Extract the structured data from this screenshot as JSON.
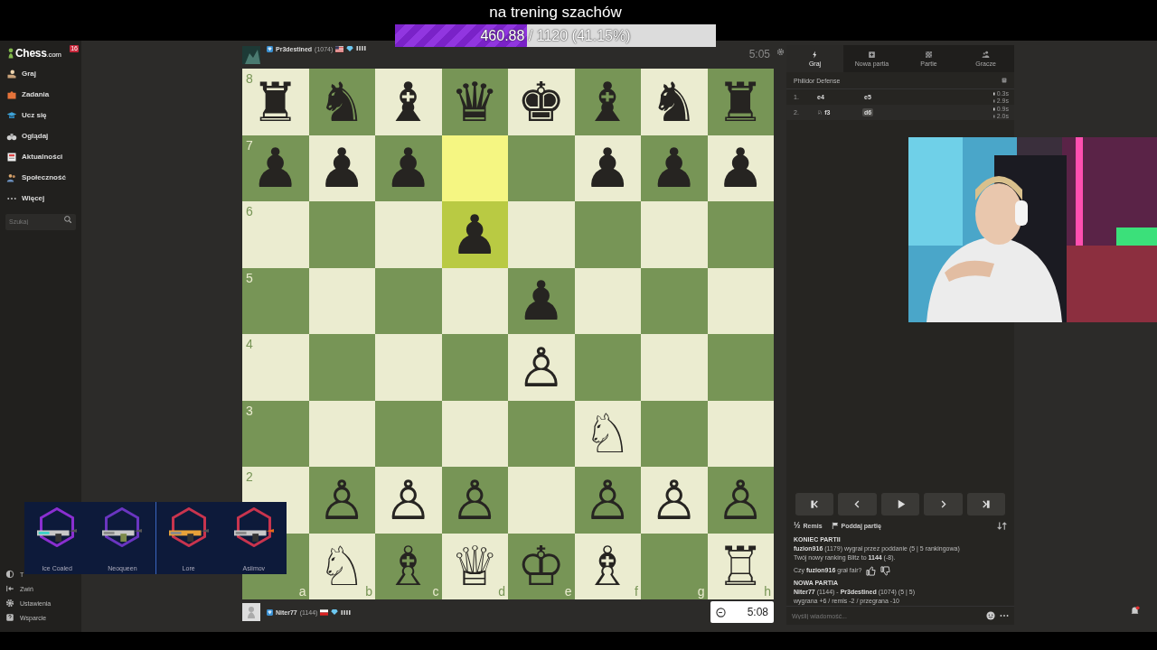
{
  "stream_overlay": {
    "title": "na trening szachów",
    "progress": {
      "level": 0.4115,
      "reading": "460.88 / 1120 (41.15%)"
    }
  },
  "sidebar": {
    "logo": {
      "name": "Chess",
      "suffix": ".com"
    },
    "notification_count": "16",
    "items": [
      {
        "label": "Graj"
      },
      {
        "label": "Zadania"
      },
      {
        "label": "Ucz się"
      },
      {
        "label": "Oglądaj"
      },
      {
        "label": "Aktualności"
      },
      {
        "label": "Społeczność"
      },
      {
        "label": "Więcej"
      }
    ],
    "search": {
      "placeholder": "Szukaj"
    },
    "footer_items": [
      {
        "label": "T"
      },
      {
        "label": "Zwiń"
      },
      {
        "label": "Ustawienia"
      },
      {
        "label": "Wsparcie"
      }
    ]
  },
  "players": [
    {
      "name": "Pr3destined",
      "rating": "(1074)",
      "clock": "5:05",
      "active": false
    },
    {
      "name": "Niter77",
      "rating": "(1144)",
      "clock": "5:08",
      "active": true
    }
  ],
  "board": {
    "ranks": [
      {
        "label": "8",
        "squares": [
          {
            "piece": "♜",
            "highlighted": false
          },
          {
            "piece": "♞",
            "highlighted": false
          },
          {
            "piece": "♝",
            "highlighted": false
          },
          {
            "piece": "♛",
            "highlighted": false
          },
          {
            "piece": "♚",
            "highlighted": false
          },
          {
            "piece": "♝",
            "highlighted": false
          },
          {
            "piece": "♞",
            "highlighted": false
          },
          {
            "piece": "♜",
            "highlighted": false
          }
        ]
      },
      {
        "label": "7",
        "squares": [
          {
            "piece": "♟",
            "highlighted": false
          },
          {
            "piece": "♟",
            "highlighted": false
          },
          {
            "piece": "♟",
            "highlighted": false
          },
          {
            "highlighted": true
          },
          {
            "highlighted": false
          },
          {
            "piece": "♟",
            "highlighted": false
          },
          {
            "piece": "♟",
            "highlighted": false
          },
          {
            "piece": "♟",
            "highlighted": false
          }
        ]
      },
      {
        "label": "6",
        "squares": [
          {
            "highlighted": false
          },
          {
            "highlighted": false
          },
          {
            "highlighted": false
          },
          {
            "piece": "♟",
            "highlighted": true
          },
          {
            "highlighted": false
          },
          {
            "highlighted": false
          },
          {
            "highlighted": false
          },
          {
            "highlighted": false
          }
        ]
      },
      {
        "label": "5",
        "squares": [
          {
            "highlighted": false
          },
          {
            "highlighted": false
          },
          {
            "highlighted": false
          },
          {
            "highlighted": false
          },
          {
            "piece": "♟",
            "highlighted": false
          },
          {
            "highlighted": false
          },
          {
            "highlighted": false
          },
          {
            "highlighted": false
          }
        ]
      },
      {
        "label": "4",
        "squares": [
          {
            "highlighted": false
          },
          {
            "highlighted": false
          },
          {
            "highlighted": false
          },
          {
            "highlighted": false
          },
          {
            "piece": "♙",
            "highlighted": false
          },
          {
            "highlighted": false
          },
          {
            "highlighted": false
          },
          {
            "highlighted": false
          }
        ]
      },
      {
        "label": "3",
        "squares": [
          {
            "highlighted": false
          },
          {
            "highlighted": false
          },
          {
            "highlighted": false
          },
          {
            "highlighted": false
          },
          {
            "highlighted": false
          },
          {
            "piece": "♘",
            "highlighted": false
          },
          {
            "highlighted": false
          },
          {
            "highlighted": false
          }
        ]
      },
      {
        "label": "2",
        "squares": [
          {
            "highlighted": false
          },
          {
            "piece": "♙",
            "highlighted": false
          },
          {
            "piece": "♙",
            "highlighted": false
          },
          {
            "piece": "♙",
            "highlighted": false
          },
          {
            "highlighted": false
          },
          {
            "piece": "♙",
            "highlighted": false
          },
          {
            "piece": "♙",
            "highlighted": false
          },
          {
            "piece": "♙",
            "highlighted": false
          }
        ]
      },
      {
        "squares": [
          {
            "file_label": "a",
            "highlighted": false
          },
          {
            "piece": "♘",
            "file_label": "b",
            "highlighted": false
          },
          {
            "piece": "♗",
            "file_label": "c",
            "highlighted": false
          },
          {
            "piece": "♕",
            "file_label": "d",
            "highlighted": false
          },
          {
            "piece": "♔",
            "file_label": "e",
            "highlighted": false
          },
          {
            "piece": "♗",
            "file_label": "f",
            "highlighted": false
          },
          {
            "file_label": "g",
            "highlighted": false
          },
          {
            "piece": "♖",
            "file_label": "h",
            "highlighted": false
          }
        ]
      }
    ]
  },
  "panel": {
    "tabs": [
      {
        "label": "Graj",
        "selected": true
      },
      {
        "label": "Nowa partia",
        "selected": false
      },
      {
        "label": "Partie",
        "selected": false
      },
      {
        "label": "Gracze",
        "selected": false
      }
    ],
    "opening": "Philidor Defense",
    "moves": [
      {
        "number": "1.",
        "white": {
          "text": "e4",
          "selected": false
        },
        "black": {
          "text": "e5",
          "selected": false
        },
        "times": [
          "0.3s",
          "2.9s"
        ]
      },
      {
        "number": "2.",
        "white": {
          "figurine": "♘",
          "text": "f3",
          "selected": false
        },
        "black": {
          "text": "d6",
          "selected": true
        },
        "times": [
          "0.9s",
          "2.0s"
        ]
      }
    ],
    "draw_offer": {
      "symbol": "½",
      "label": "Remis"
    },
    "resign": {
      "label": "Poddaj partię"
    },
    "chat": [
      {
        "kind": "heading",
        "text": "KONIEC PARTII"
      },
      {
        "kind": "text",
        "text": "**fuzion916** (1179) wygrał przez poddanie (5 | 5 rankingowa)"
      },
      {
        "kind": "text",
        "text": "Twój nowy ranking Blitz to **1144** (-8)."
      },
      {
        "kind": "fair",
        "text": "Czy **fuzion916** grał fair?"
      },
      {
        "kind": "heading",
        "text": "NOWA PARTIA"
      },
      {
        "kind": "text",
        "text": "**Niter77** (1144) - **Pr3destined** (1074) (5 | 5)"
      },
      {
        "kind": "text",
        "text": "wygrana +6 / remis -2 / przegrana -10"
      }
    ],
    "message": {
      "placeholder": "Wyślij wiadomość..."
    }
  },
  "skins": [
    {
      "name": "Ice Coaled",
      "color": "#8a2fd0"
    },
    {
      "name": "Neoqueen",
      "color": "#6a35c0"
    },
    {
      "name": "Lore",
      "color": "#c8344e"
    },
    {
      "name": "Asiimov",
      "color": "#c8344e"
    }
  ]
}
